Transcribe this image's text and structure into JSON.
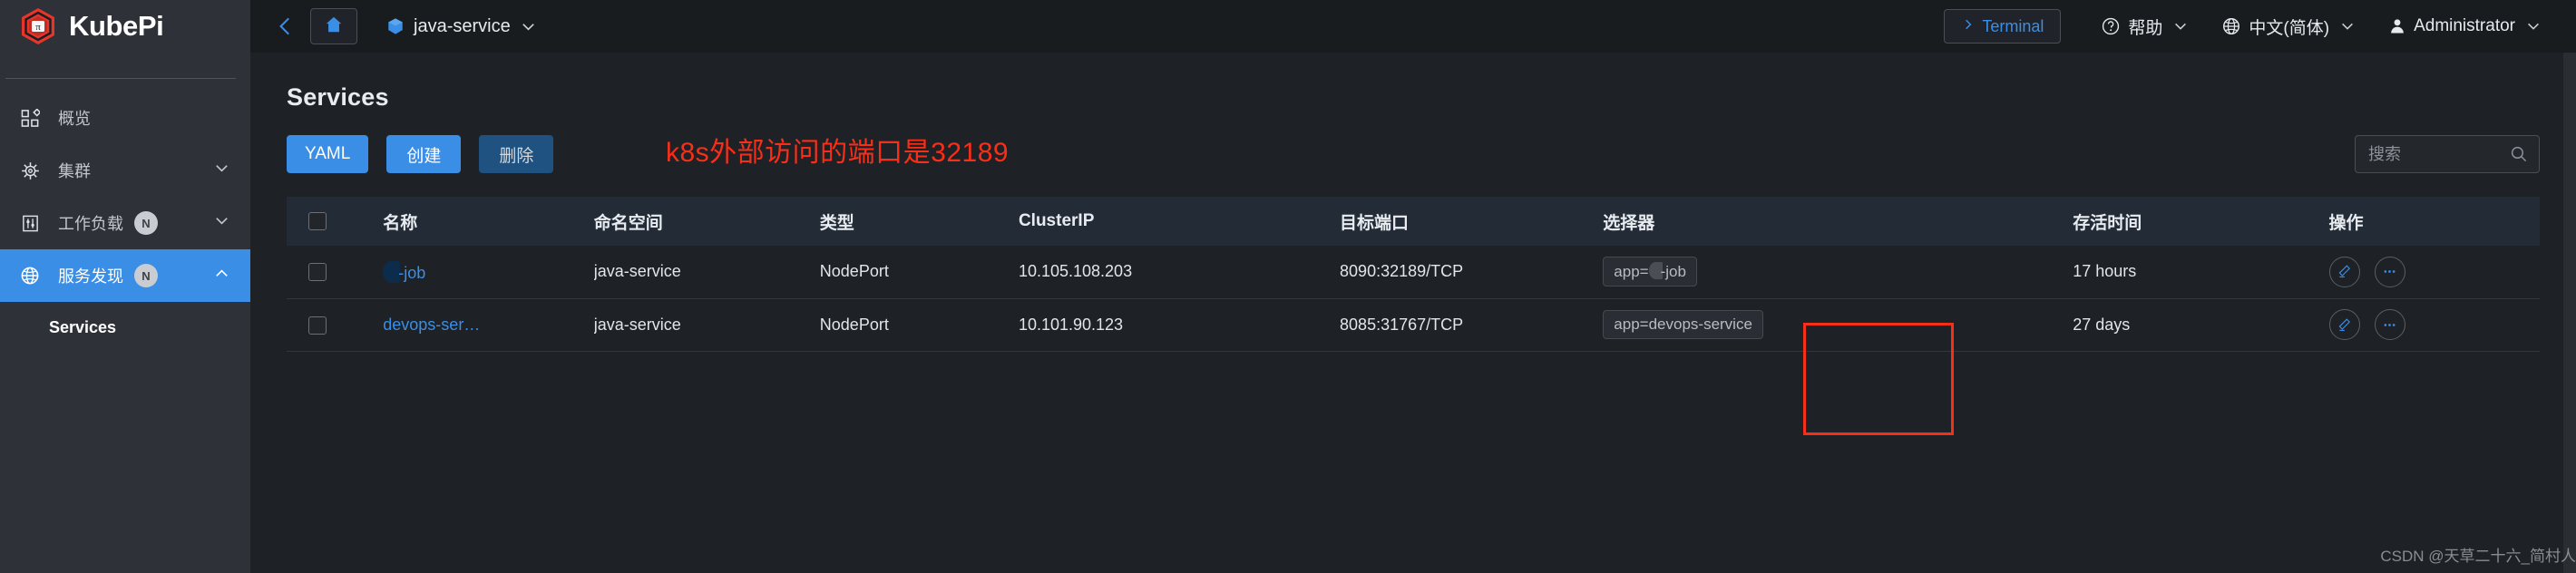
{
  "brand": {
    "name": "KubePi",
    "logo_icon": "kubepi-hexagon-logo"
  },
  "sidebar": {
    "items": [
      {
        "label": "概览",
        "icon": "dashboard-grid-icon",
        "badge": "",
        "chevron": "",
        "active": false
      },
      {
        "label": "集群",
        "icon": "helm-wheel-icon",
        "badge": "",
        "chevron": "chevron-down-icon",
        "active": false
      },
      {
        "label": "工作负载",
        "icon": "sliders-icon",
        "badge": "N",
        "chevron": "chevron-down-icon",
        "active": false
      },
      {
        "label": "服务发现",
        "icon": "globe-icon",
        "badge": "N",
        "chevron": "chevron-up-icon",
        "active": true
      }
    ],
    "sub_items": [
      {
        "label": "Services",
        "active": true
      }
    ]
  },
  "topbar": {
    "back_icon": "chevron-left-icon",
    "home_icon": "home-icon",
    "breadcrumb": {
      "icon": "cube-icon",
      "label": "java-service",
      "chevron": "chevron-down-icon"
    },
    "terminal": {
      "label": "Terminal",
      "icon": "chevron-right-icon"
    },
    "help": {
      "label": "帮助",
      "icon": "question-circle-icon",
      "chevron": "chevron-down-icon"
    },
    "language": {
      "label": "中文(简体)",
      "icon": "globe-icon",
      "chevron": "chevron-down-icon"
    },
    "user": {
      "label": "Administrator",
      "icon": "user-icon",
      "chevron": "chevron-down-icon"
    }
  },
  "page": {
    "title": "Services",
    "buttons": {
      "yaml": "YAML",
      "create": "创建",
      "delete": "删除"
    },
    "annotation": "k8s外部访问的端口是32189",
    "search": {
      "value": "",
      "placeholder": "搜索",
      "icon": "search-icon"
    }
  },
  "table": {
    "columns": [
      {
        "key": "select",
        "label": ""
      },
      {
        "key": "name",
        "label": "名称"
      },
      {
        "key": "namespace",
        "label": "命名空间"
      },
      {
        "key": "type",
        "label": "类型"
      },
      {
        "key": "clusterip",
        "label": "ClusterIP"
      },
      {
        "key": "ports",
        "label": "目标端口"
      },
      {
        "key": "selector",
        "label": "选择器"
      },
      {
        "key": "age",
        "label": "存活时间"
      },
      {
        "key": "ops",
        "label": "操作"
      }
    ],
    "rows": [
      {
        "name_prefix_redacted": true,
        "name": "-job",
        "namespace": "java-service",
        "type": "NodePort",
        "clusterip": "10.105.108.203",
        "ports": "8090:32189/TCP",
        "selector_prefix": "app=",
        "selector_redacted": true,
        "selector_suffix": "-job",
        "age": "17 hours",
        "ops": [
          "edit-icon",
          "more-icon"
        ]
      },
      {
        "name_prefix_redacted": false,
        "name": "devops-ser…",
        "namespace": "java-service",
        "type": "NodePort",
        "clusterip": "10.101.90.123",
        "ports": "8085:31767/TCP",
        "selector_prefix": "app=devops-service",
        "selector_redacted": false,
        "selector_suffix": "",
        "age": "27 days",
        "ops": [
          "edit-icon",
          "more-icon"
        ]
      }
    ]
  },
  "watermark": "CSDN @天草二十六_简村人",
  "colors": {
    "accent_blue": "#3a8ee6",
    "annotation_red": "#f82f18",
    "sidebar_bg": "#2e3238",
    "main_bg": "#1e2226",
    "topbar_bg": "#191c1f",
    "table_head_bg": "#232b36",
    "logo_red": "#e8352b"
  }
}
